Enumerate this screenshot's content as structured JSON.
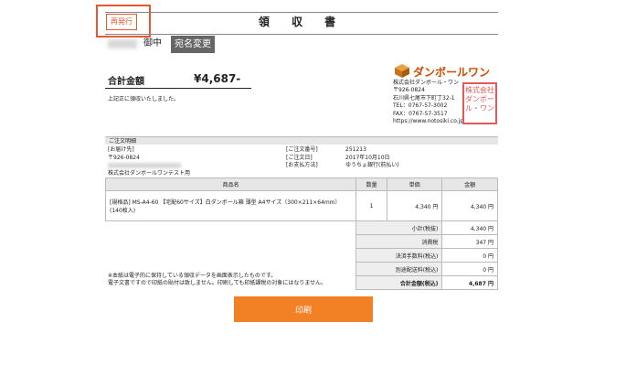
{
  "header": {
    "reissue_label": "再発行",
    "title": "領 収 書"
  },
  "recipient": {
    "honorific": "御中",
    "change_name_label": "宛名変更"
  },
  "total": {
    "label": "合計金額",
    "amount": "¥4,687-"
  },
  "thanks_text": "上記正に領収いたしました。",
  "company": {
    "logo_text": "ダンボールワン",
    "name": "株式会社ダンボール・ワン",
    "postal": "〒926-0824",
    "address": "石川県七尾市下町丁32-1",
    "tel": "TEL：0767-57-3002",
    "fax": "FAX：0767-57-3517",
    "url": "https://www.notosiki.co.jp",
    "seal_text": "株式会社ダンボール・ワン"
  },
  "order_details": {
    "section_label": "ご注文明細",
    "ship_to_label": "[お届け先]",
    "ship_to_postal": "〒926-0824",
    "ship_to_company": "株式会社ダンボールワンテスト用",
    "order_no_label": "[ご注文番号]",
    "order_no": "251213",
    "order_date_label": "[ご注文日]",
    "order_date": "2017年10月10日",
    "payment_label": "[お支払方法]",
    "payment_method": "ゆうちょ銀行(前払い)"
  },
  "table": {
    "headers": {
      "product": "商品名",
      "qty": "数量",
      "unit_price": "単価",
      "amount": "金額"
    },
    "item": {
      "name": "[規格品] MS-A4-60 【宅配60サイズ】白ダンボール箱 薄型 A4サイズ（300×211×64mm）(140枚入)",
      "qty": "1",
      "unit_price": "4,340 円",
      "amount": "4,340 円"
    },
    "summary": [
      {
        "label": "小計(税抜)",
        "value": "4,340 円"
      },
      {
        "label": "消費税",
        "value": "347 円"
      },
      {
        "label": "決済手数料(税込)",
        "value": "0 円"
      },
      {
        "label": "別途配送料(税込)",
        "value": "0 円"
      },
      {
        "label": "合計金額(税込)",
        "value": "4,687 円"
      }
    ]
  },
  "notice": {
    "line1": "※本紙は電子的に保持している領収データを画面表示したものです。",
    "line2": "電子文書ですので印紙の貼付は致しません。印刷しても印紙課税の対象にはなりません。"
  },
  "print_label": "印刷",
  "colors": {
    "accent": "#f28024",
    "highlight": "#e9572e",
    "seal": "#e05a5a",
    "logo": "#d04a02"
  }
}
